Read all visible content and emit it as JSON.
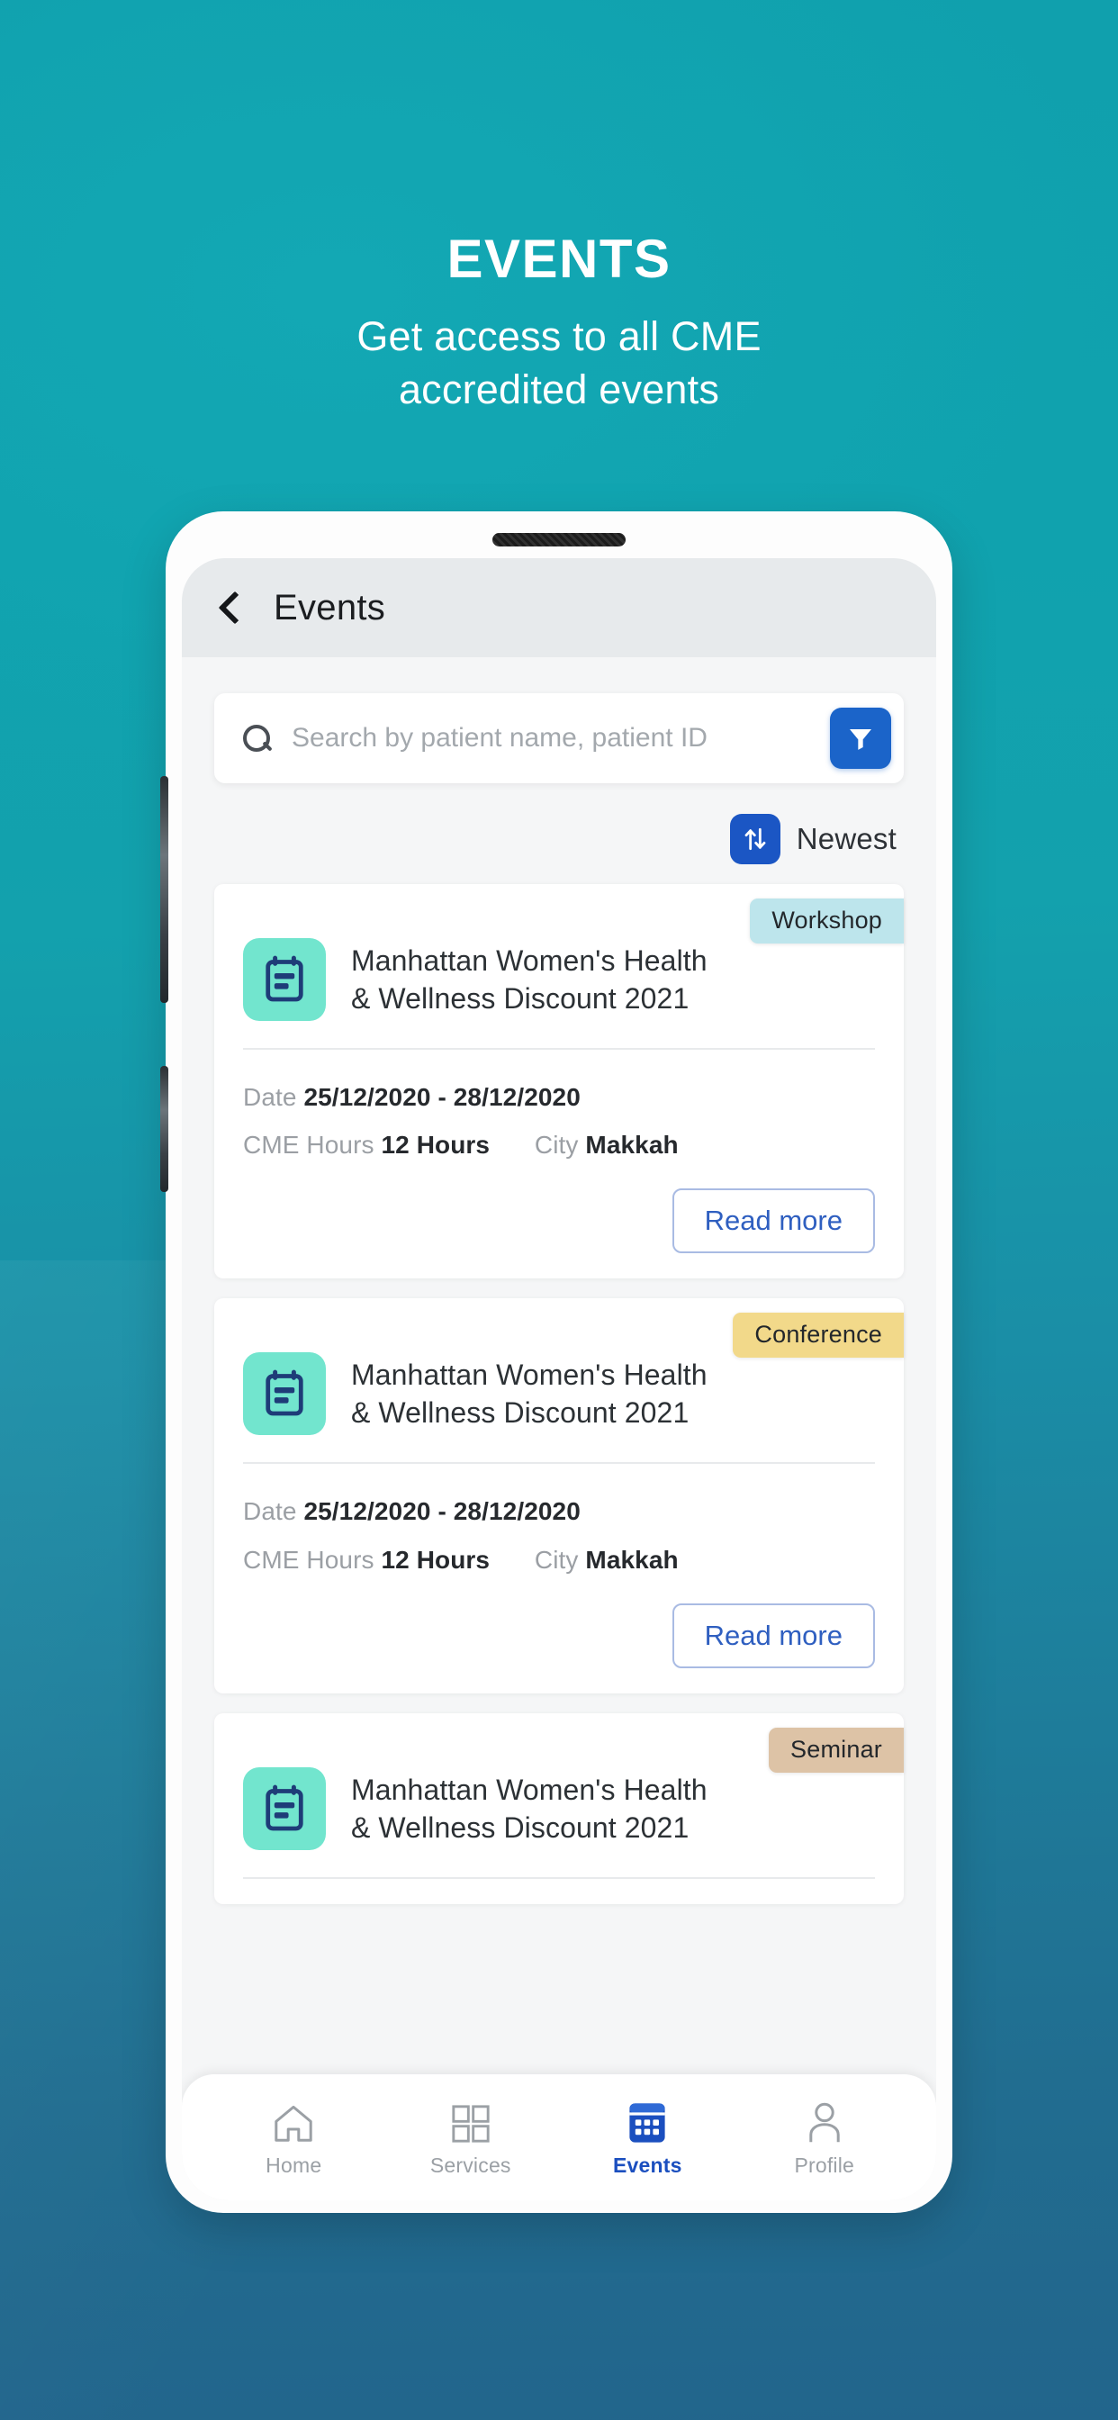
{
  "promo": {
    "title": "EVENTS",
    "subtitle_line1": "Get access to all CME",
    "subtitle_line2": "accredited events"
  },
  "colors": {
    "bg_top": "#10a0ad",
    "bg_bottom": "#22658c",
    "accent_blue": "#1b64c9",
    "icon_mint": "#72e5ce",
    "icon_navy": "#1e3c78",
    "badge_workshop": "#bde5ec",
    "badge_conference": "#f2d98a",
    "badge_seminar": "#ddc3a6",
    "active_nav": "#1b4fbf"
  },
  "appbar": {
    "back_icon": "chevron-left-icon",
    "title": "Events"
  },
  "search": {
    "icon": "search-icon",
    "placeholder": "Search by patient name, patient ID",
    "value": "",
    "filter_icon": "filter-funnel-icon"
  },
  "sort": {
    "icon": "sort-arrows-icon",
    "label": "Newest"
  },
  "labels": {
    "date": "Date",
    "cme_hours": "CME Hours",
    "city": "City",
    "read_more": "Read more"
  },
  "cards": [
    {
      "badge": "Workshop",
      "badge_color": "#bde5ec",
      "icon": "calendar-icon",
      "title_line1": "Manhattan Women's Health",
      "title_line2": "& Wellness Discount 2021",
      "date": "25/12/2020 - 28/12/2020",
      "hours": "12 Hours",
      "city": "Makkah",
      "read_more": "Read more"
    },
    {
      "badge": "Conference",
      "badge_color": "#f2d98a",
      "icon": "calendar-icon",
      "title_line1": "Manhattan Women's Health",
      "title_line2": "& Wellness Discount 2021",
      "date": "25/12/2020 - 28/12/2020",
      "hours": "12 Hours",
      "city": "Makkah",
      "read_more": "Read more"
    },
    {
      "badge": "Seminar",
      "badge_color": "#ddc3a6",
      "icon": "calendar-icon",
      "title_line1": "Manhattan Women's Health",
      "title_line2": "& Wellness Discount 2021",
      "date": "",
      "hours": "",
      "city": "",
      "read_more": ""
    }
  ],
  "bottom_nav": [
    {
      "label": "Home",
      "icon": "home-icon",
      "active": false
    },
    {
      "label": "Services",
      "icon": "grid-icon",
      "active": false
    },
    {
      "label": "Events",
      "icon": "calendar-icon",
      "active": true
    },
    {
      "label": "Profile",
      "icon": "person-icon",
      "active": false
    }
  ]
}
